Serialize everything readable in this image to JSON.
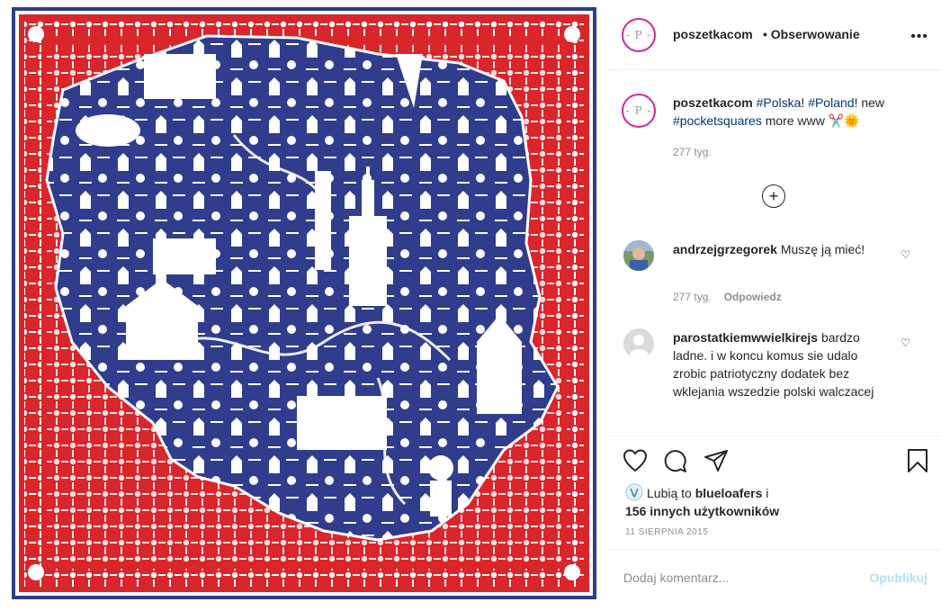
{
  "post": {
    "author": "poszetkacom",
    "separator": "•",
    "follow_label": "Obserwowanie",
    "more_label": "•••",
    "avatar_logo_text": "- P -"
  },
  "caption": {
    "author": "poszetkacom",
    "tag1": "#Polska",
    "text1": "! ",
    "tag2": "#Poland",
    "text2": "! new ",
    "tag3": "#pocketsquares",
    "text3": " more www ✂️🌞",
    "time": "277 tyg."
  },
  "load_more_label": "+",
  "comments": [
    {
      "author": "andrzejgrzegorek",
      "text": "Muszę ją mieć!",
      "time": "277 tyg.",
      "reply": "Odpowiedz"
    },
    {
      "author": "parostatkiemwwielkirejs",
      "text": "bardzo ladne. i w koncu komus sie udalo zrobic patriotyczny dodatek bez wklejania wszedzie polski walczacej"
    }
  ],
  "likes": {
    "prefix": "Lubią to ",
    "user": "blueloafers",
    "mid": " i",
    "count_text": "156 innych użytkowników"
  },
  "date": "11 SIERPNIA 2015",
  "add_comment_placeholder": "Dodaj komentarz...",
  "publish_label": "Opublikuj",
  "colors": {
    "scarf_red": "#d9262b",
    "scarf_blue": "#2f3d8c",
    "link": "#00376b",
    "muted": "#8e8e8e",
    "publish_disabled": "#b2dffc"
  }
}
